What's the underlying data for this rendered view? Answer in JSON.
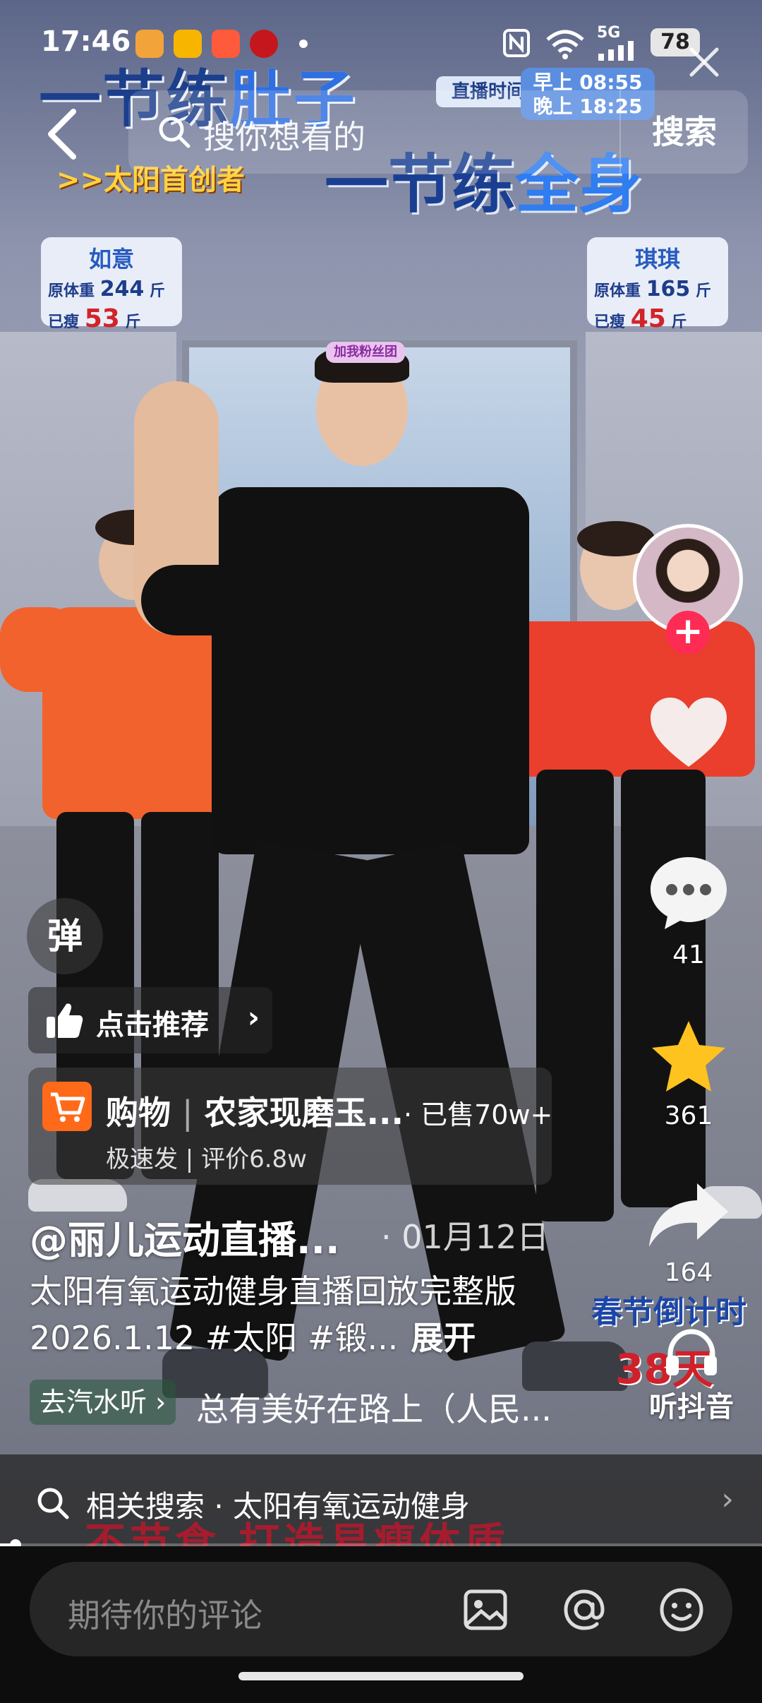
{
  "status_bar": {
    "time": "17:46",
    "signal_label": "5G",
    "battery": "78",
    "app_icons": [
      {
        "name": "wallet-app-icon",
        "color": "#f2a33a"
      },
      {
        "name": "video-app-icon",
        "color": "#f7b500"
      },
      {
        "name": "store-app-icon",
        "color": "#ff5a3c"
      },
      {
        "name": "news-app-icon",
        "color": "#c6161d"
      }
    ]
  },
  "search": {
    "placeholder": "搜你想看的",
    "button_label": "搜索"
  },
  "video_overlay": {
    "line1_prefix": "一节练",
    "line1_highlight": "肚子",
    "line2_prefix": "一节练",
    "line2_highlight": "全身",
    "subtitle": ">>太阳首创者",
    "live_time_label": "直播时间",
    "live_time_morning": "早上 08:55",
    "live_time_evening": "晚上 18:25",
    "stat_cards": [
      {
        "name": "如意",
        "orig_label": "原体重",
        "orig_value": "244",
        "unit": "斤",
        "lost_label": "已瘦",
        "lost_value": "53"
      },
      {
        "name": "琪琪",
        "orig_label": "原体重",
        "orig_value": "165",
        "unit": "斤",
        "lost_label": "已瘦",
        "lost_value": "45"
      }
    ],
    "headband_tag": "加我粉丝团",
    "countdown_label": "春节倒计时",
    "countdown_days": "38天",
    "bottom_banner": "不节食 打造易瘦体质"
  },
  "right_rail": {
    "comments_count": "41",
    "favorites_count": "361",
    "shares_count": "164",
    "listen_label": "听抖音",
    "follow_symbol": "+"
  },
  "left_panel": {
    "danmu_label": "弹",
    "recommend_label": "点击推荐",
    "shop": {
      "category": "购物",
      "title": "农家现磨玉...",
      "sold": "· 已售70w+",
      "sub": "极速发 | 评价6.8w"
    },
    "author": "@丽儿运动直播...",
    "date": "· 01月12日",
    "description": "太阳有氧运动健身直播回放完整版2026.1.12 #太阳 #锻...",
    "expand_label": "展开",
    "music_tag": "去汽水听 ›",
    "music_text": "总有美好在路上（人民..."
  },
  "related_search": {
    "text": "相关搜索 · 太阳有氧运动健身"
  },
  "playback": {
    "progress_fraction": 0.02
  },
  "comment_bar": {
    "placeholder": "期待你的评论"
  }
}
